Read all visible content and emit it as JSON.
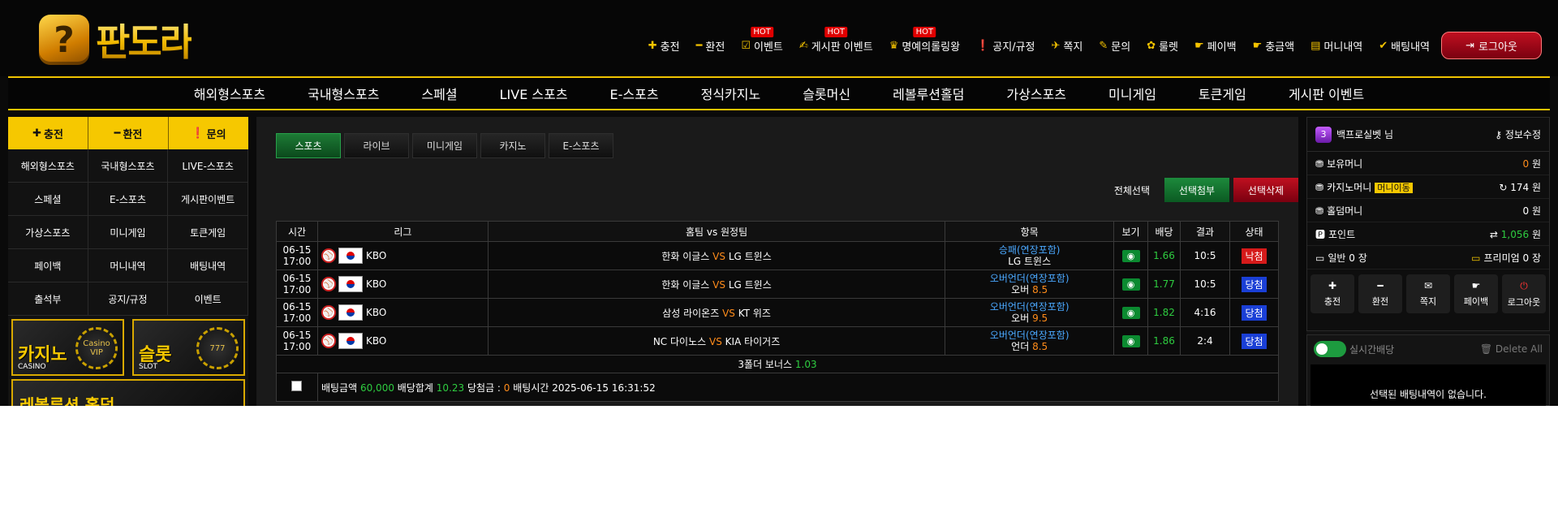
{
  "header": {
    "logo_mark": "?",
    "logo_text": "판도라",
    "top_nav": [
      {
        "label": "충전",
        "icon": "plus-icon",
        "glyph": "✚",
        "hot": ""
      },
      {
        "label": "환전",
        "icon": "minus-icon",
        "glyph": "━",
        "hot": ""
      },
      {
        "label": "이벤트",
        "icon": "calendar-check-icon",
        "glyph": "☑",
        "hot": "HOT"
      },
      {
        "label": "게시판 이벤트",
        "icon": "hand-coin-icon",
        "glyph": "✍",
        "hot": "HOT"
      },
      {
        "label": "명예의롤링왕",
        "icon": "trophy-icon",
        "glyph": "♛",
        "hot": "HOT"
      },
      {
        "label": "공지/규정",
        "icon": "alert-icon",
        "glyph": "❗",
        "hot": ""
      },
      {
        "label": "쪽지",
        "icon": "paper-plane-icon",
        "glyph": "✈",
        "hot": ""
      },
      {
        "label": "문의",
        "icon": "edit-icon",
        "glyph": "✎",
        "hot": ""
      },
      {
        "label": "룰렛",
        "icon": "gift-icon",
        "glyph": "✿",
        "hot": ""
      },
      {
        "label": "페이백",
        "icon": "hand-coin-icon",
        "glyph": "☛",
        "hot": ""
      },
      {
        "label": "충금액",
        "icon": "hand-coin-icon",
        "glyph": "☛",
        "hot": ""
      },
      {
        "label": "머니내역",
        "icon": "clipboard-icon",
        "glyph": "▤",
        "hot": ""
      },
      {
        "label": "배팅내역",
        "icon": "check-icon",
        "glyph": "✔",
        "hot": ""
      }
    ],
    "logout_label": "로그아웃"
  },
  "main_nav": [
    "해외형스포츠",
    "국내형스포츠",
    "스페셜",
    "LIVE 스포츠",
    "E-스포츠",
    "정식카지노",
    "슬롯머신",
    "레볼루션홀덤",
    "가상스포츠",
    "미니게임",
    "토큰게임",
    "게시판 이벤트"
  ],
  "left": {
    "quick_buttons": [
      {
        "label": "충전",
        "glyph": "✚"
      },
      {
        "label": "환전",
        "glyph": "━"
      },
      {
        "label": "문의",
        "glyph": "❗"
      }
    ],
    "grid": [
      "해외형스포츠",
      "국내형스포츠",
      "LIVE-스포츠",
      "스페셜",
      "E-스포츠",
      "게시판이벤트",
      "가상스포츠",
      "미니게임",
      "토큰게임",
      "페이백",
      "머니내역",
      "배팅내역",
      "출석부",
      "공지/규정",
      "이벤트"
    ],
    "banners": [
      {
        "title": "카지노",
        "sub": "CASINO",
        "chip": "Casino VIP"
      },
      {
        "title": "슬롯",
        "sub": "SLOT",
        "chip": "777"
      }
    ],
    "banner_wide": "레볼루션 홀덤"
  },
  "center": {
    "tabs": [
      "스포츠",
      "라이브",
      "미니게임",
      "카지노",
      "E-스포츠"
    ],
    "active_tab": 0,
    "select_all": "전체선택",
    "btn_attach": "선택첨부",
    "btn_delete": "선택삭제",
    "columns": [
      "시간",
      "리그",
      "홈팀 vs 원정팀",
      "항목",
      "보기",
      "배당",
      "결과",
      "상태"
    ],
    "rows": [
      {
        "date": "06-15",
        "time": "17:00",
        "league": "KBO",
        "home": "한화 이글스",
        "vs": "VS",
        "away": "LG 트윈스",
        "market": "승패(연장포함)",
        "pick": "LG 트윈스",
        "line": "",
        "odds": "1.66",
        "result": "10:5",
        "status": "낙첨",
        "status_type": "lose"
      },
      {
        "date": "06-15",
        "time": "17:00",
        "league": "KBO",
        "home": "한화 이글스",
        "vs": "VS",
        "away": "LG 트윈스",
        "market": "오버언더(연장포함)",
        "pick": "오버",
        "line": "8.5",
        "odds": "1.77",
        "result": "10:5",
        "status": "당첨",
        "status_type": "win"
      },
      {
        "date": "06-15",
        "time": "17:00",
        "league": "KBO",
        "home": "삼성 라이온즈",
        "vs": "VS",
        "away": "KT 위즈",
        "market": "오버언더(연장포함)",
        "pick": "오버",
        "line": "9.5",
        "odds": "1.82",
        "result": "4:16",
        "status": "당첨",
        "status_type": "win"
      },
      {
        "date": "06-15",
        "time": "17:00",
        "league": "KBO",
        "home": "NC 다이노스",
        "vs": "VS",
        "away": "KIA 타이거즈",
        "market": "오버언더(연장포함)",
        "pick": "언더",
        "line": "8.5",
        "odds": "1.86",
        "result": "2:4",
        "status": "당첨",
        "status_type": "win"
      }
    ],
    "bonus_label": "3폴더 보너스",
    "bonus_value": "1.03",
    "summary": {
      "bet_amount_label": "배팅금액",
      "bet_amount": "60,000",
      "odds_total_label": "배당합계",
      "odds_total": "10.23",
      "win_label": "당첨금 :",
      "win_amount": "0",
      "time_label": "배팅시간",
      "time": "2025-06-15 16:31:52"
    }
  },
  "right": {
    "level": "3",
    "username": "백프로실벳 님",
    "edit_label": "정보수정",
    "rows": [
      {
        "label": "보유머니",
        "value": "0",
        "unit": "원",
        "value_color": "#ff8c1a"
      },
      {
        "label": "카지노머니",
        "badge": "머니이동",
        "value": "174",
        "unit": "원",
        "value_color": "#ffffff"
      },
      {
        "label": "홀덤머니",
        "value": "0",
        "unit": "원",
        "value_color": "#ffffff"
      },
      {
        "label": "포인트",
        "value": "1,056",
        "unit": "원",
        "value_color": "#2ecc40"
      }
    ],
    "normal_label": "일반",
    "normal_value": "0 장",
    "premium_label": "프리미엄",
    "premium_value": "0 장",
    "buttons": [
      {
        "label": "충전",
        "icon": "plus-square-icon",
        "glyph": "✚"
      },
      {
        "label": "환전",
        "icon": "minus-square-icon",
        "glyph": "━"
      },
      {
        "label": "쪽지",
        "icon": "envelope-icon",
        "glyph": "✉"
      },
      {
        "label": "페이백",
        "icon": "hand-coin-icon",
        "glyph": "☛"
      },
      {
        "label": "로그아웃",
        "icon": "power-icon",
        "glyph": "⏻"
      }
    ],
    "slip_toggle_label": "실시간배당",
    "slip_delete_label": "Delete All",
    "slip_empty": "선택된 배팅내역이 없습니다."
  },
  "colors": {
    "accent": "#f6c800",
    "win": "#1a3fd6",
    "lose": "#d61a1a",
    "odds": "#2ecc40",
    "vs": "#ff8c1a"
  }
}
